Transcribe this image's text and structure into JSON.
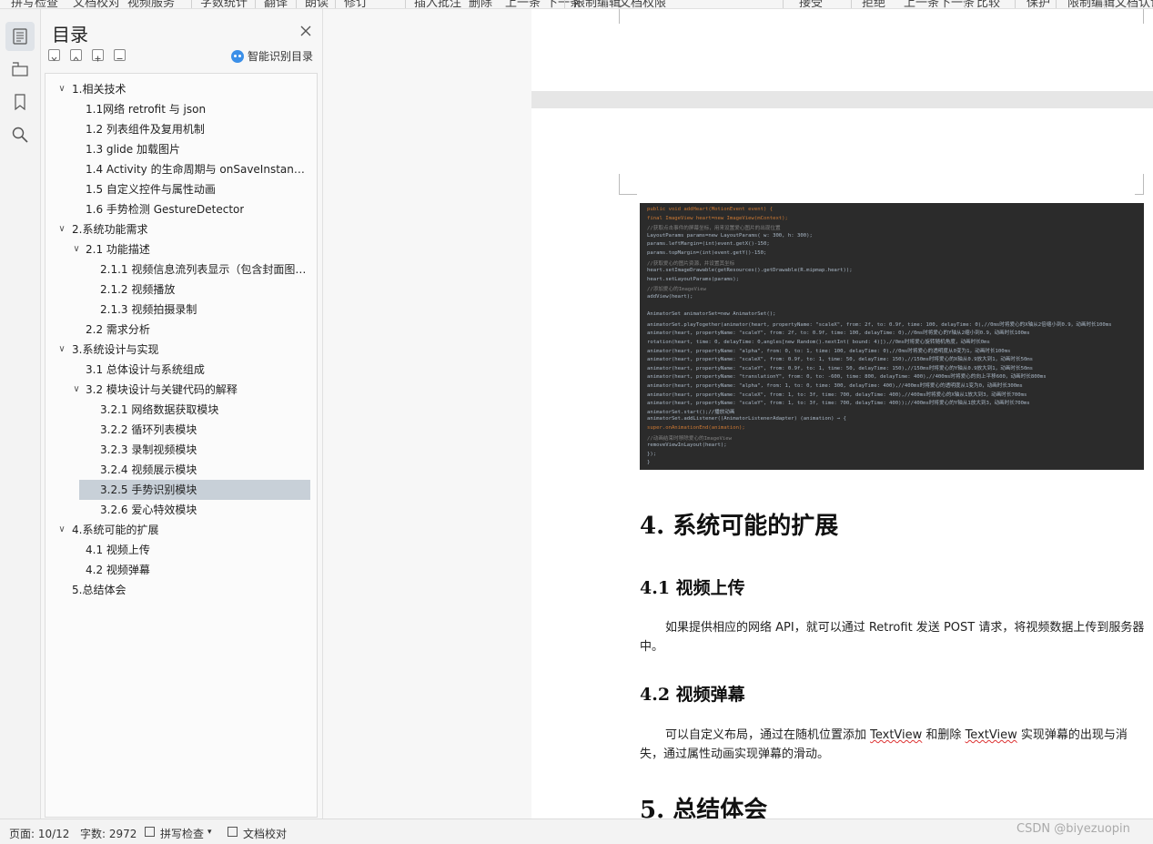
{
  "toolbar": {
    "items": [
      "拼写检查",
      "文档校对",
      "视频服务",
      "字数统计",
      "翻译",
      "朗读",
      "修订",
      "插入批注",
      "删除",
      "上一条",
      "下一条",
      "限制编辑",
      "文档权限",
      "接受",
      "拒绝",
      "上一条",
      "下一条",
      "比较",
      "保护",
      "限制编辑",
      "文档认证"
    ]
  },
  "rail": {
    "icons": [
      "toc-icon",
      "nav-pane-icon",
      "bookmark-icon",
      "search-icon"
    ]
  },
  "toc_panel": {
    "title": "目录",
    "smart_label": "智能识别目录",
    "items": [
      {
        "text": "1.相关技术",
        "level": 0,
        "expanded": true
      },
      {
        "text": "1.1网络 retrofit 与 json",
        "level": 1
      },
      {
        "text": "1.2 列表组件及复用机制",
        "level": 1
      },
      {
        "text": "1.3  glide 加载图片",
        "level": 1
      },
      {
        "text": "1.4  Activity 的生命周期与 onSaveInstanceState",
        "level": 1
      },
      {
        "text": "1.5 自定义控件与属性动画",
        "level": 1
      },
      {
        "text": "1.6 手势检测 GestureDetector",
        "level": 1
      },
      {
        "text": "2.系统功能需求",
        "level": 0,
        "expanded": true
      },
      {
        "text": "2.1 功能描述",
        "level": 1,
        "expanded": true
      },
      {
        "text": "2.1.1 视频信息流列表显示（包含封面图片）",
        "level": 2
      },
      {
        "text": "2.1.2 视频播放",
        "level": 2
      },
      {
        "text": "2.1.3 视频拍摄录制",
        "level": 2
      },
      {
        "text": "2.2 需求分析",
        "level": 1
      },
      {
        "text": "3.系统设计与实现",
        "level": 0,
        "expanded": true
      },
      {
        "text": "3.1 总体设计与系统组成",
        "level": 1
      },
      {
        "text": "3.2 模块设计与关键代码的解释",
        "level": 1,
        "expanded": true
      },
      {
        "text": "3.2.1 网络数据获取模块",
        "level": 2
      },
      {
        "text": "3.2.2 循环列表模块",
        "level": 2
      },
      {
        "text": "3.2.3 录制视频模块",
        "level": 2
      },
      {
        "text": "3.2.4 视频展示模块",
        "level": 2
      },
      {
        "text": "3.2.5 手势识别模块",
        "level": 2,
        "selected": true
      },
      {
        "text": "3.2.6 爱心特效模块",
        "level": 2
      },
      {
        "text": "4.系统可能的扩展",
        "level": 0,
        "expanded": true
      },
      {
        "text": "4.1 视频上传",
        "level": 1
      },
      {
        "text": "4.2  视频弹幕",
        "level": 1
      },
      {
        "text": "5.总结体会",
        "level": 0
      }
    ]
  },
  "document": {
    "code_lines": [
      "public void addHeart(MotionEvent event) {",
      "    final ImageView heart=new ImageView(mContext);",
      "    //获取点击事件的屏幕坐标，用来设置爱心图片的出现位置",
      "    LayoutParams params=new LayoutParams( w: 300, h: 300);",
      "    params.leftMargin=(int)event.getX()-150;",
      "    params.topMargin=(int)event.getY()-150;",
      "    //获取爱心的图片资源，并设置其坐标",
      "    heart.setImageDrawable(getResources().getDrawable(R.mipmap.heart));",
      "    heart.setLayoutParams(params);",
      "    //添加爱心的ImageView",
      "    addView(heart);",
      "",
      "    AnimatorSet animatorSet=new AnimatorSet();",
      "    animatorSet.playTogether(animator(heart, propertyName: \"scaleX\", from: 2f, to: 0.9f, time: 100, delayTime: 0),//0ms时将爱心的X轴从2倍缩小到0.9，动画时长100ms",
      "            animator(heart, propertyName: \"scaleY\", from: 2f, to: 0.9f, time: 100, delayTime: 0),//0ms时将爱心的Y轴从2缩小到0.9，动画时长100ms",
      "            rotation(heart, time: 0, delayTime: 0,angles[new Random().nextInt( bound: 4)]),//0ms时将爱心旋转随机角度，动画时长0ms",
      "            animator(heart, propertyName: \"alpha\", from: 0, to: 1, time: 100, delayTime: 0),//0ms时将爱心的透明度从0变为1，动画时长100ms",
      "            animator(heart, propertyName: \"scaleX\", from: 0.9f, to: 1, time: 50, delayTime: 150),//150ms时将爱心的X轴从0.9放大到1，动画时长50ms",
      "            animator(heart, propertyName: \"scaleY\", from: 0.9f, to: 1, time: 50, delayTime: 150),//150ms时将爱心的Y轴从0.9放大到1，动画时长50ms",
      "            animator(heart, propertyName: \"translationY\", from: 0, to: -600, time: 800, delayTime: 400),//400ms时将爱心的向上平移600，动画时长800ms",
      "            animator(heart, propertyName: \"alpha\", from: 1, to: 0, time: 300, delayTime: 400),//400ms时将爱心的透明度从1变为0，动画时长300ms",
      "            animator(heart, propertyName: \"scaleX\", from: 1, to: 3f, time: 700, delayTime: 400),//400ms时将爱心的X轴从1放大到3，动画时长700ms",
      "            animator(heart, propertyName: \"scaleY\", from: 1, to: 3f, time: 700, delayTime: 400));//400ms时将爱心的Y轴从1放大到3，动画时长700ms",
      "    animatorSet.start();//播放动画",
      "    animatorSet.addListener((AnimatorListenerAdapter) (animation) → {",
      "            super.onAnimationEnd(animation);",
      "            //动画结束时移除爱心的ImageView",
      "            removeViewInLayout(heart);",
      "    });",
      "}"
    ],
    "h1_4": "4. 系统可能的扩展",
    "h2_41": "4.1 视频上传",
    "p_41": "如果提供相应的网络 API，就可以通过 Retrofit 发送 POST 请求，将视频数据上传到服务器中。",
    "h2_42": "4.2  视频弹幕",
    "p_42_a": "可以自定义布局，通过在随机位置添加 ",
    "p_42_tv1": "TextView",
    "p_42_b": " 和删除 ",
    "p_42_tv2": "TextView",
    "p_42_c": " 实现弹幕的出现与消失，通过属性动画实现弹幕的滑动。",
    "h1_5": "5. 总结体会"
  },
  "status_bar": {
    "page": "页面: 10/12",
    "words": "字数: 2972",
    "spell": "拼写检查",
    "proof": "文档校对"
  },
  "watermark": "CSDN @biyezuopin"
}
